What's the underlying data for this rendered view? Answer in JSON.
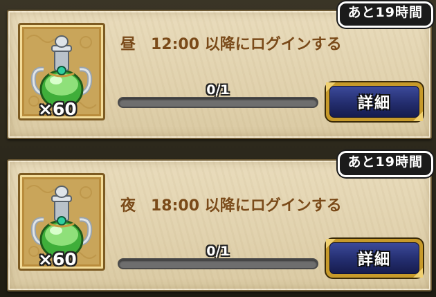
{
  "missions": [
    {
      "timer": "あと19時間",
      "label": "昼　12:00 以降にログインする",
      "reward_qty": "×60",
      "progress_text": "0/1",
      "progress_fraction": 0,
      "button_label": "詳細",
      "reward_icon": "green-potion-icon"
    },
    {
      "timer": "あと19時間",
      "label": "夜　18:00 以降にログインする",
      "reward_qty": "×60",
      "progress_text": "0/1",
      "progress_fraction": 0,
      "button_label": "詳細",
      "reward_icon": "green-potion-icon"
    }
  ],
  "colors": {
    "label": "#7a4a19",
    "card": "#e6d8b5",
    "button_frame": "#c79a2a",
    "button_fill": "#232d6e"
  }
}
